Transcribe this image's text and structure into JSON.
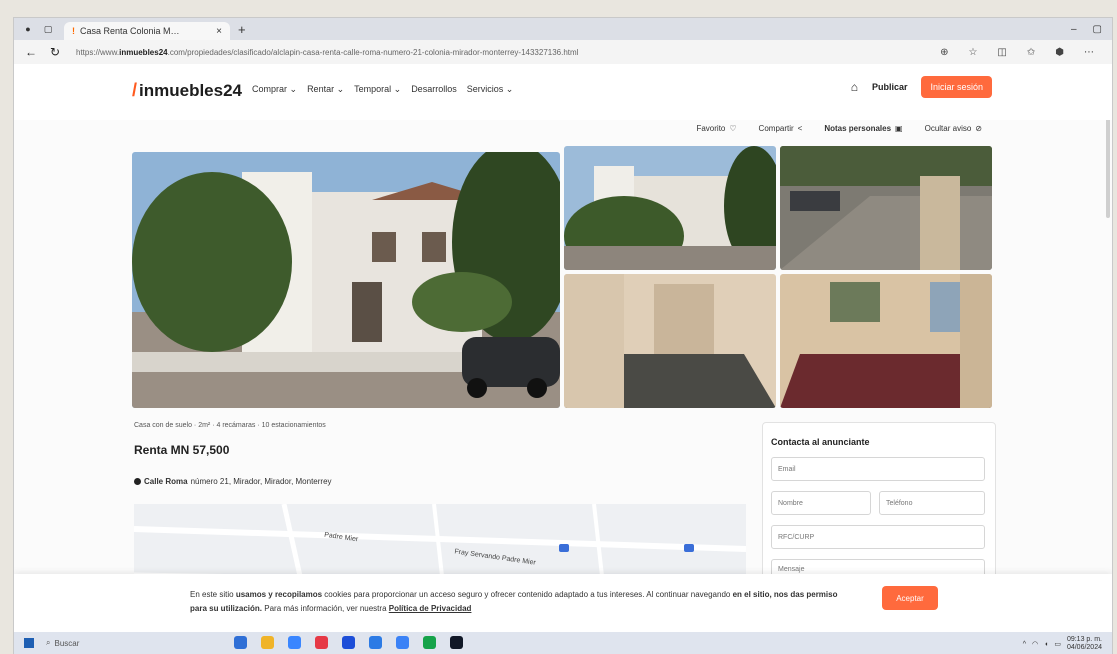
{
  "browser": {
    "tab_title": "Casa Renta Colonia Mirador N°…",
    "new_tab": "+",
    "tab_close": "×",
    "url_prefix": "https://www.",
    "url_domain": "inmuebles24",
    "url_rest": ".com/propiedades/clasificado/alclapin-casa-renta-calle-roma-numero-21-colonia-mirador-monterrey-143327136.html",
    "back": "←",
    "reload": "↻"
  },
  "header": {
    "logo_text": "inmuebles24",
    "nav": [
      "Comprar ⌄",
      "Rentar ⌄",
      "Temporal ⌄",
      "Desarrollos",
      "Servicios ⌄"
    ],
    "publicar": "Publicar",
    "login": "Iniciar sesión"
  },
  "actions": {
    "favorito": "Favorito",
    "compartir": "Compartir",
    "notas": "Notas personales",
    "ocultar": "Ocultar aviso"
  },
  "listing": {
    "features": "Casa con de suelo · 2m² · 4 recámaras · 10 estacionamientos",
    "price": "Renta MN 57,500",
    "address_bold": "Calle Roma",
    "address_rest": " número 21, Mirador, Mirador, Monterrey"
  },
  "map": {
    "label1": "Padre Mier",
    "label2": "Fray Servando Padre Mier",
    "label3": "Padre Mier"
  },
  "contact": {
    "title": "Contacta al anunciante",
    "email": "Email",
    "nombre": "Nombre",
    "telefono": "Teléfono",
    "id": "RFC/CURP",
    "mensaje": "Mensaje"
  },
  "cookie": {
    "text_1": "En este sitio ",
    "text_bold_1": "usamos y recopilamos",
    "text_2": " cookies para proporcionar un acceso seguro y ofrecer contenido adaptado a tus intereses. Al continuar navegando ",
    "text_bold_2": "en el sitio, nos das permiso para su utilización.",
    "text_3": " Para más información, ver nuestra ",
    "link": "Política de Privacidad",
    "accept": "Aceptar"
  },
  "taskbar": {
    "search": "Buscar",
    "time": "09:13 p. m.",
    "date": "04/06/2024"
  },
  "colors": {
    "brand": "#ff5a1f",
    "accent_button": "#ff6a3d"
  }
}
